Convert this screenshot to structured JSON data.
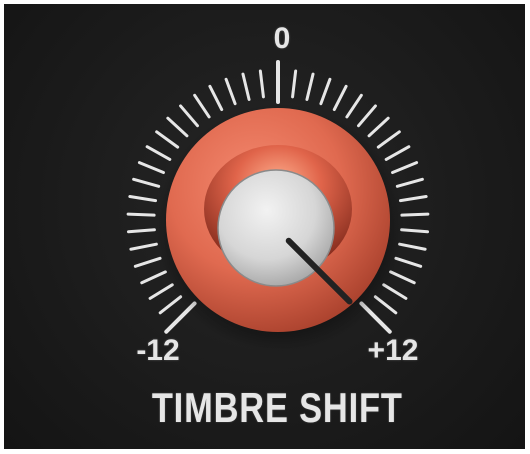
{
  "knob": {
    "label": "TIMBRE SHIFT",
    "scale_min_label": "-12",
    "scale_center_label": "0",
    "scale_max_label": "+12",
    "min": -12,
    "max": 12,
    "value": 12,
    "colors": {
      "panel": "#1a1a1a",
      "outer_ring": "#e06a50",
      "inner_cap": "#d9d9d9",
      "indicator": "#222222",
      "ticks": "#e6e6e6"
    }
  }
}
